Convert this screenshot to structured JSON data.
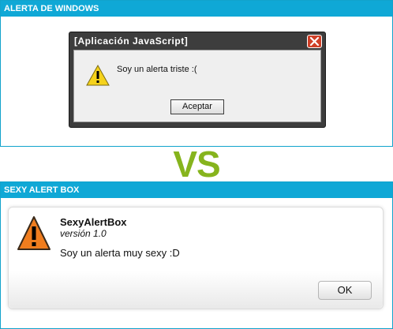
{
  "top_panel": {
    "header": "ALERTA DE WINDOWS"
  },
  "windows_alert": {
    "title": "[Aplicación JavaScript]",
    "message": "Soy un alerta triste :(",
    "button": "Aceptar",
    "icon": "warning-icon"
  },
  "vs_text": "VS",
  "bottom_panel": {
    "header": "SEXY ALERT BOX"
  },
  "sexy_alert": {
    "title": "SexyAlertBox",
    "subtitle": "versión 1.0",
    "message": "Soy un alerta muy sexy :D",
    "button": "OK",
    "icon": "warning-icon"
  },
  "colors": {
    "header_blue": "#0fa8d6",
    "vs_green": "#86b41d",
    "close_red": "#cf3f27",
    "sexy_warning_orange": "#f07d1e"
  }
}
